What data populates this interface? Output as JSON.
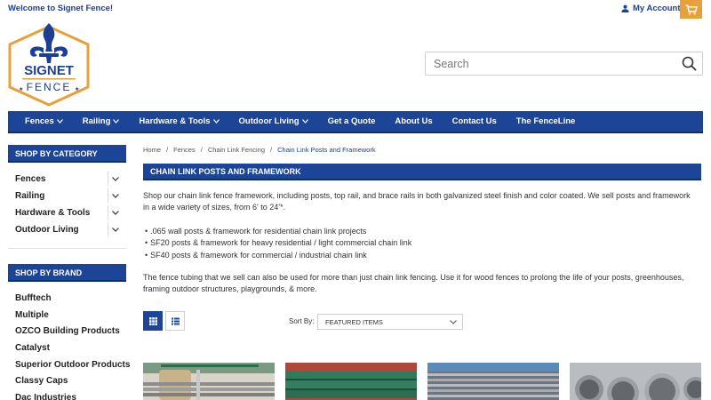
{
  "header": {
    "welcome": "Welcome to Signet Fence!",
    "account": "My Account",
    "search_placeholder": "Search",
    "logo": {
      "line1": "SIGNET",
      "line2": "FENCE"
    }
  },
  "nav": [
    {
      "label": "Fences",
      "dropdown": true
    },
    {
      "label": "Railing",
      "dropdown": true
    },
    {
      "label": "Hardware & Tools",
      "dropdown": true
    },
    {
      "label": "Outdoor Living",
      "dropdown": true
    },
    {
      "label": "Get a Quote",
      "dropdown": false
    },
    {
      "label": "About Us",
      "dropdown": false
    },
    {
      "label": "Contact Us",
      "dropdown": false
    },
    {
      "label": "The FenceLine",
      "dropdown": false
    }
  ],
  "sidebar": {
    "category_heading": "SHOP BY CATEGORY",
    "categories": [
      "Fences",
      "Railing",
      "Hardware & Tools",
      "Outdoor Living"
    ],
    "brand_heading": "SHOP BY BRAND",
    "brands": [
      "Bufftech",
      "Multiple",
      "OZCO Building Products",
      "Catalyst",
      "Superior Outdoor Products",
      "Classy Caps",
      "Dac Industries"
    ]
  },
  "breadcrumb": [
    "Home",
    "Fences",
    "Chain Link Fencing",
    "Chain Link Posts and Framework"
  ],
  "page": {
    "title": "CHAIN LINK POSTS AND FRAMEWORK",
    "description": "Shop our chain link fence framework, including posts, top rail, and brace rails in both galvanized steel finish and color coated. We sell posts and framework in a wide variety of sizes, from 6' to 24'*.",
    "bullets": [
      ".065 wall posts & framework for residential chain link projects",
      "SF20 posts & framework for heavy residential / light commercial chain link",
      "SF40 posts & framework for commercial / industrial chain link"
    ],
    "description2": "The fence tubing that we sell can also be used for more than just chain link fencing. Use it for wood fences to prolong the life of your posts, greenhouses, framing outdoor structures, playgrounds, & more."
  },
  "toolbar": {
    "sort_label": "Sort By:",
    "sort_value": "FEATURED ITEMS"
  },
  "colors": {
    "brand_blue": "#1c4598",
    "accent_orange": "#e8a13a",
    "text_link": "#1c3f94"
  }
}
